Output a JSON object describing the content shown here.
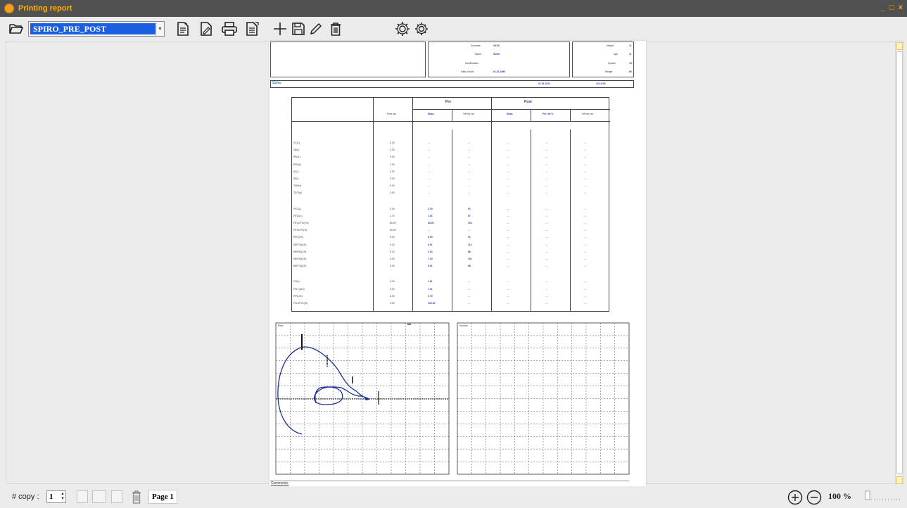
{
  "window": {
    "title": "Printing report",
    "controls": [
      "_",
      "□",
      "×"
    ]
  },
  "toolbar": {
    "report_name": "SPIRO_PRE_POST",
    "icons": [
      "open-folder-icon",
      "new-document-icon",
      "edit-document-icon",
      "print-icon",
      "export-icon",
      "add-icon",
      "save-icon",
      "pencil-icon",
      "trash-icon",
      "settings-icon",
      "settings-alt-icon"
    ]
  },
  "report": {
    "header": {
      "left_labels": [
        "Surname",
        "Name",
        "Identification",
        "Date of birth"
      ],
      "left_values": [
        "XXXX",
        "Smith",
        "",
        "01.01.1980"
      ],
      "right_labels": [
        "Height",
        "Age",
        "System",
        "Weight"
      ],
      "right_values": [
        "11",
        "11",
        "XX",
        "80"
      ]
    },
    "section": {
      "label": "Spiro",
      "date": "01.01.2022",
      "time": "10:10:00"
    },
    "table": {
      "group_headers": [
        "Pre",
        "Post"
      ],
      "col_headers": [
        "Pred.val.",
        "Meas.",
        "%Pred.val.",
        "Meas.",
        "Pre. dif %",
        "%Pred.val."
      ],
      "groups": [
        [
          [
            "VC(L)",
            "3.20",
            "---",
            "---",
            "---",
            "---",
            "---"
          ],
          [
            "VA(L)",
            "3.20",
            "---",
            "---",
            "---",
            "---",
            "---"
          ],
          [
            "IRV(L)",
            "0.00",
            "---",
            "---",
            "---",
            "---",
            "---"
          ],
          [
            "ERV(L)",
            "1.00",
            "---",
            "---",
            "---",
            "---",
            "---"
          ],
          [
            "IC(L)",
            "2.00",
            "---",
            "---",
            "---",
            "---",
            "---"
          ],
          [
            "ID(L)",
            "0.00",
            "---",
            "---",
            "---",
            "---",
            "---"
          ],
          [
            "TI(Sec)",
            "0.00",
            "---",
            "---",
            "---",
            "---",
            "---"
          ],
          [
            "TE/Ti(s)",
            "0.00",
            "---",
            "---",
            "---",
            "---",
            "---"
          ]
        ],
        [
          [
            "FVC(L)",
            "3.00",
            "3.20",
            "91",
            "---",
            "---",
            "---"
          ],
          [
            "FEV1(L)",
            "1.70",
            "1.52",
            "87",
            "---",
            "---",
            "---"
          ],
          [
            "FEV1/FVC(%)",
            "80.00",
            "83.00",
            "104",
            "---",
            "---",
            "---"
          ],
          [
            "FEV1/VC(%)",
            "80.00",
            "---",
            "---",
            "---",
            "---",
            "---"
          ],
          [
            "PEF(L/S)",
            "6.00",
            "6.00",
            "91",
            "---",
            "---",
            "---"
          ],
          [
            "MEF75(L/S)",
            "4.20",
            "6.01",
            "113",
            "---",
            "---",
            "---"
          ],
          [
            "MEF50(L/S)",
            "3.20",
            "3.04",
            "86",
            "---",
            "---",
            "---"
          ],
          [
            "MEF25(L/S)",
            "0.00",
            "7.20",
            "101",
            "---",
            "---",
            "---"
          ],
          [
            "MEF75(L/S)",
            "0.00",
            "6.01",
            "86",
            "---",
            "---",
            "---"
          ]
        ],
        [
          [
            "FIV(L)",
            "0.00",
            "1.01",
            "---",
            "---",
            "---",
            "---"
          ],
          [
            "FIV1 (sec)",
            "0.00",
            "1.01",
            "---",
            "---",
            "---",
            "---"
          ],
          [
            "PIF(L/S)",
            "0.00",
            "3.70",
            "---",
            "---",
            "---",
            "---"
          ],
          [
            "FIV1/FVC(%)",
            "0.00",
            "100.00",
            "---",
            "---",
            "---",
            "---"
          ]
        ]
      ]
    },
    "graph_left_title": "Flow",
    "graph_right_title": "Volume",
    "comments_label": "Comments:"
  },
  "statusbar": {
    "copy_label": "# copy :",
    "copy_value": "1",
    "page_label": "Page 1",
    "zoom": "100 %"
  }
}
